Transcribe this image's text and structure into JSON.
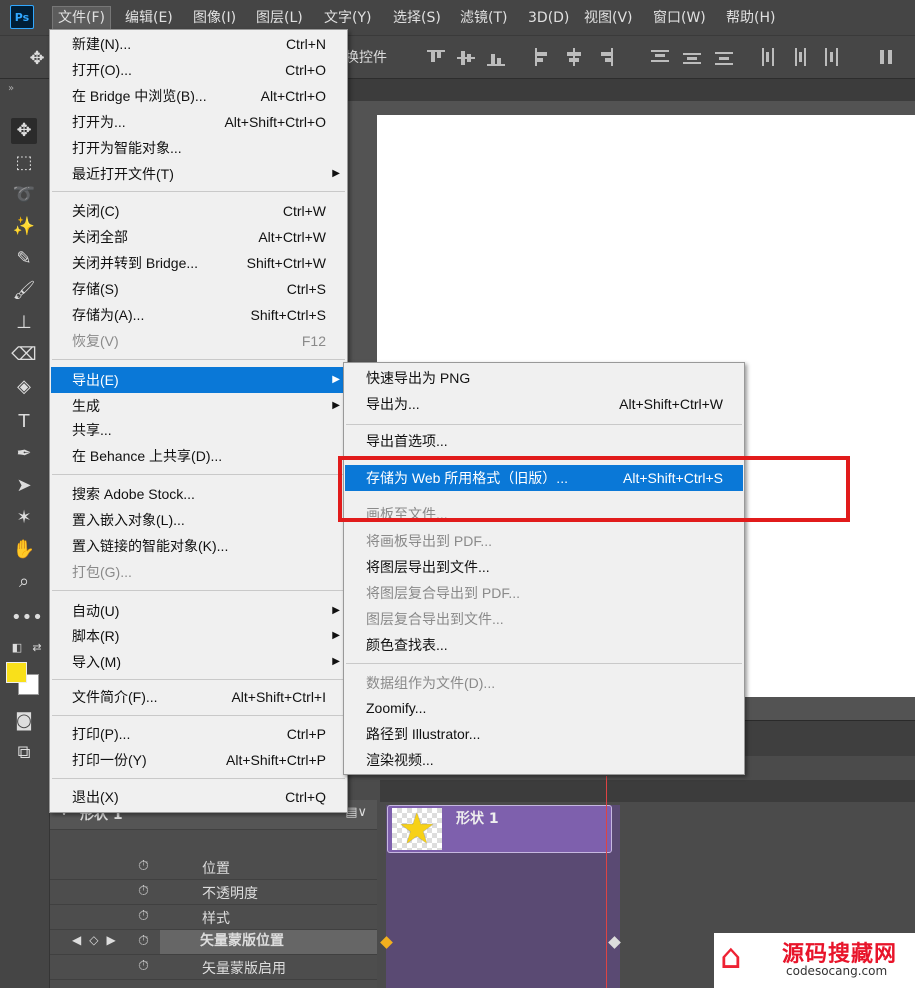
{
  "app": {
    "logo": "Ps"
  },
  "menubar": [
    {
      "label": "文件(F)"
    },
    {
      "label": "编辑(E)"
    },
    {
      "label": "图像(I)"
    },
    {
      "label": "图层(L)"
    },
    {
      "label": "文字(Y)"
    },
    {
      "label": "选择(S)"
    },
    {
      "label": "滤镜(T)"
    },
    {
      "label": "3D(D)"
    },
    {
      "label": "视图(V)"
    },
    {
      "label": "窗口(W)"
    },
    {
      "label": "帮助(H)"
    }
  ],
  "options_bar": {
    "transform_label": "换控件"
  },
  "file_menu": [
    {
      "label": "新建(N)...",
      "shortcut": "Ctrl+N"
    },
    {
      "label": "打开(O)...",
      "shortcut": "Ctrl+O"
    },
    {
      "label": "在 Bridge 中浏览(B)...",
      "shortcut": "Alt+Ctrl+O"
    },
    {
      "label": "打开为...",
      "shortcut": "Alt+Shift+Ctrl+O"
    },
    {
      "label": "打开为智能对象...",
      "shortcut": ""
    },
    {
      "label": "最近打开文件(T)",
      "shortcut": ""
    },
    {
      "label": "关闭(C)",
      "shortcut": "Ctrl+W"
    },
    {
      "label": "关闭全部",
      "shortcut": "Alt+Ctrl+W"
    },
    {
      "label": "关闭并转到 Bridge...",
      "shortcut": "Shift+Ctrl+W"
    },
    {
      "label": "存储(S)",
      "shortcut": "Ctrl+S"
    },
    {
      "label": "存储为(A)...",
      "shortcut": "Shift+Ctrl+S"
    },
    {
      "label": "恢复(V)",
      "shortcut": "F12"
    },
    {
      "label": "导出(E)",
      "shortcut": ""
    },
    {
      "label": "生成",
      "shortcut": ""
    },
    {
      "label": "共享...",
      "shortcut": ""
    },
    {
      "label": "在 Behance 上共享(D)...",
      "shortcut": ""
    },
    {
      "label": "搜索 Adobe Stock...",
      "shortcut": ""
    },
    {
      "label": "置入嵌入对象(L)...",
      "shortcut": ""
    },
    {
      "label": "置入链接的智能对象(K)...",
      "shortcut": ""
    },
    {
      "label": "打包(G)...",
      "shortcut": ""
    },
    {
      "label": "自动(U)",
      "shortcut": ""
    },
    {
      "label": "脚本(R)",
      "shortcut": ""
    },
    {
      "label": "导入(M)",
      "shortcut": ""
    },
    {
      "label": "文件简介(F)...",
      "shortcut": "Alt+Shift+Ctrl+I"
    },
    {
      "label": "打印(P)...",
      "shortcut": "Ctrl+P"
    },
    {
      "label": "打印一份(Y)",
      "shortcut": "Alt+Shift+Ctrl+P"
    },
    {
      "label": "退出(X)",
      "shortcut": "Ctrl+Q"
    }
  ],
  "export_menu": [
    {
      "label": "快速导出为 PNG",
      "shortcut": ""
    },
    {
      "label": "导出为...",
      "shortcut": "Alt+Shift+Ctrl+W"
    },
    {
      "label": "导出首选项...",
      "shortcut": ""
    },
    {
      "label": "存储为 Web 所用格式（旧版）...",
      "shortcut": "Alt+Shift+Ctrl+S"
    },
    {
      "label": "画板至文件...",
      "shortcut": ""
    },
    {
      "label": "将画板导出到 PDF...",
      "shortcut": ""
    },
    {
      "label": "将图层导出到文件...",
      "shortcut": ""
    },
    {
      "label": "将图层复合导出到 PDF...",
      "shortcut": ""
    },
    {
      "label": "图层复合导出到文件...",
      "shortcut": ""
    },
    {
      "label": "颜色查找表...",
      "shortcut": ""
    },
    {
      "label": "数据组作为文件(D)...",
      "shortcut": ""
    },
    {
      "label": "Zoomify...",
      "shortcut": ""
    },
    {
      "label": "路径到 Illustrator...",
      "shortcut": ""
    },
    {
      "label": "渲染视频...",
      "shortcut": ""
    }
  ],
  "timeline": {
    "layer_name": "形状 1",
    "clip_label": "形状 1",
    "properties": [
      "位置",
      "不透明度",
      "样式",
      "矢量蒙版位置",
      "矢量蒙版启用"
    ]
  },
  "watermark": {
    "title": "源码搜藏网",
    "url": "codesocang.com"
  },
  "colors": {
    "accent": "#0a78d7",
    "foreground": "#f9e01a",
    "highlight_box": "#e11b1b",
    "clip": "#7e60ad"
  }
}
